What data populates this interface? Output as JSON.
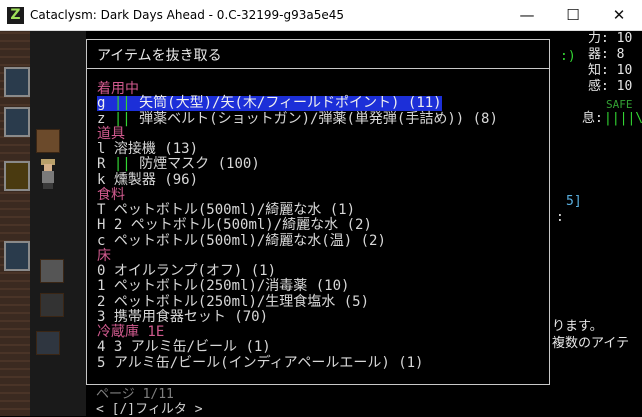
{
  "window": {
    "title": "Cataclysm: Dark Days Ahead - 0.C-32199-g93a5e45",
    "app_icon": "Z",
    "minimize": "—",
    "maximize": "☐",
    "close": "✕"
  },
  "right_panel": {
    "stats": [
      "力: 10",
      "器: 8",
      "知: 10",
      "感: 10"
    ],
    "safe": "SAFE",
    "face": ":)",
    "breath_label": "息:",
    "breath_bars": "||||\\",
    "bracket_text": "5]",
    "colon_text": ":",
    "msg1": "ります。",
    "msg2": "複数のアイテ"
  },
  "dialog": {
    "title": "アイテムを抜き取る",
    "categories": {
      "worn": "着用中",
      "tools": "道具",
      "food": "食料",
      "floor": "床",
      "fridge": "冷蔵庫 1E"
    },
    "worn_items": [
      {
        "key": "g",
        "mark": "||",
        "name": "矢筒(大型)/矢(木/フィールドポイント) (11)"
      },
      {
        "key": "z",
        "mark": "||",
        "name": "弾薬ベルト(ショットガン)/弾薬(単発弾(手詰め)) (8)"
      }
    ],
    "tool_items": [
      {
        "key": "l",
        "mark": "",
        "name": "溶接機 (13)"
      },
      {
        "key": "R",
        "mark": "||",
        "name": "防煙マスク (100)"
      },
      {
        "key": "k",
        "mark": "",
        "name": "燻製器 (96)"
      }
    ],
    "food_items": [
      {
        "key": "T",
        "name": "ペットボトル(500ml)/綺麗な水 (1)"
      },
      {
        "key": "H",
        "name": "2 ペットボトル(500ml)/綺麗な水 (2)"
      },
      {
        "key": "c",
        "name": "ペットボトル(500ml)/綺麗な水(温) (2)"
      }
    ],
    "floor_items": [
      {
        "key": "0",
        "name": "オイルランプ(オフ) (1)"
      },
      {
        "key": "1",
        "name": "ペットボトル(250ml)/消毒薬 (10)"
      },
      {
        "key": "2",
        "name": "ペットボトル(250ml)/生理食塩水 (5)"
      },
      {
        "key": "3",
        "name": "携帯用食器セット (70)"
      }
    ],
    "fridge_items": [
      {
        "key": "4",
        "name": "3 アルミ缶/ビール (1)"
      },
      {
        "key": "5",
        "name": "アルミ缶/ビール(インディアペールエール) (1)"
      }
    ],
    "page": "ページ 1/11",
    "filter": "< [/]フィルタ >"
  },
  "colors": {
    "category": "#d05a8e",
    "selected_bg": "#1c2fd8",
    "wear_mark": "#33d633"
  }
}
